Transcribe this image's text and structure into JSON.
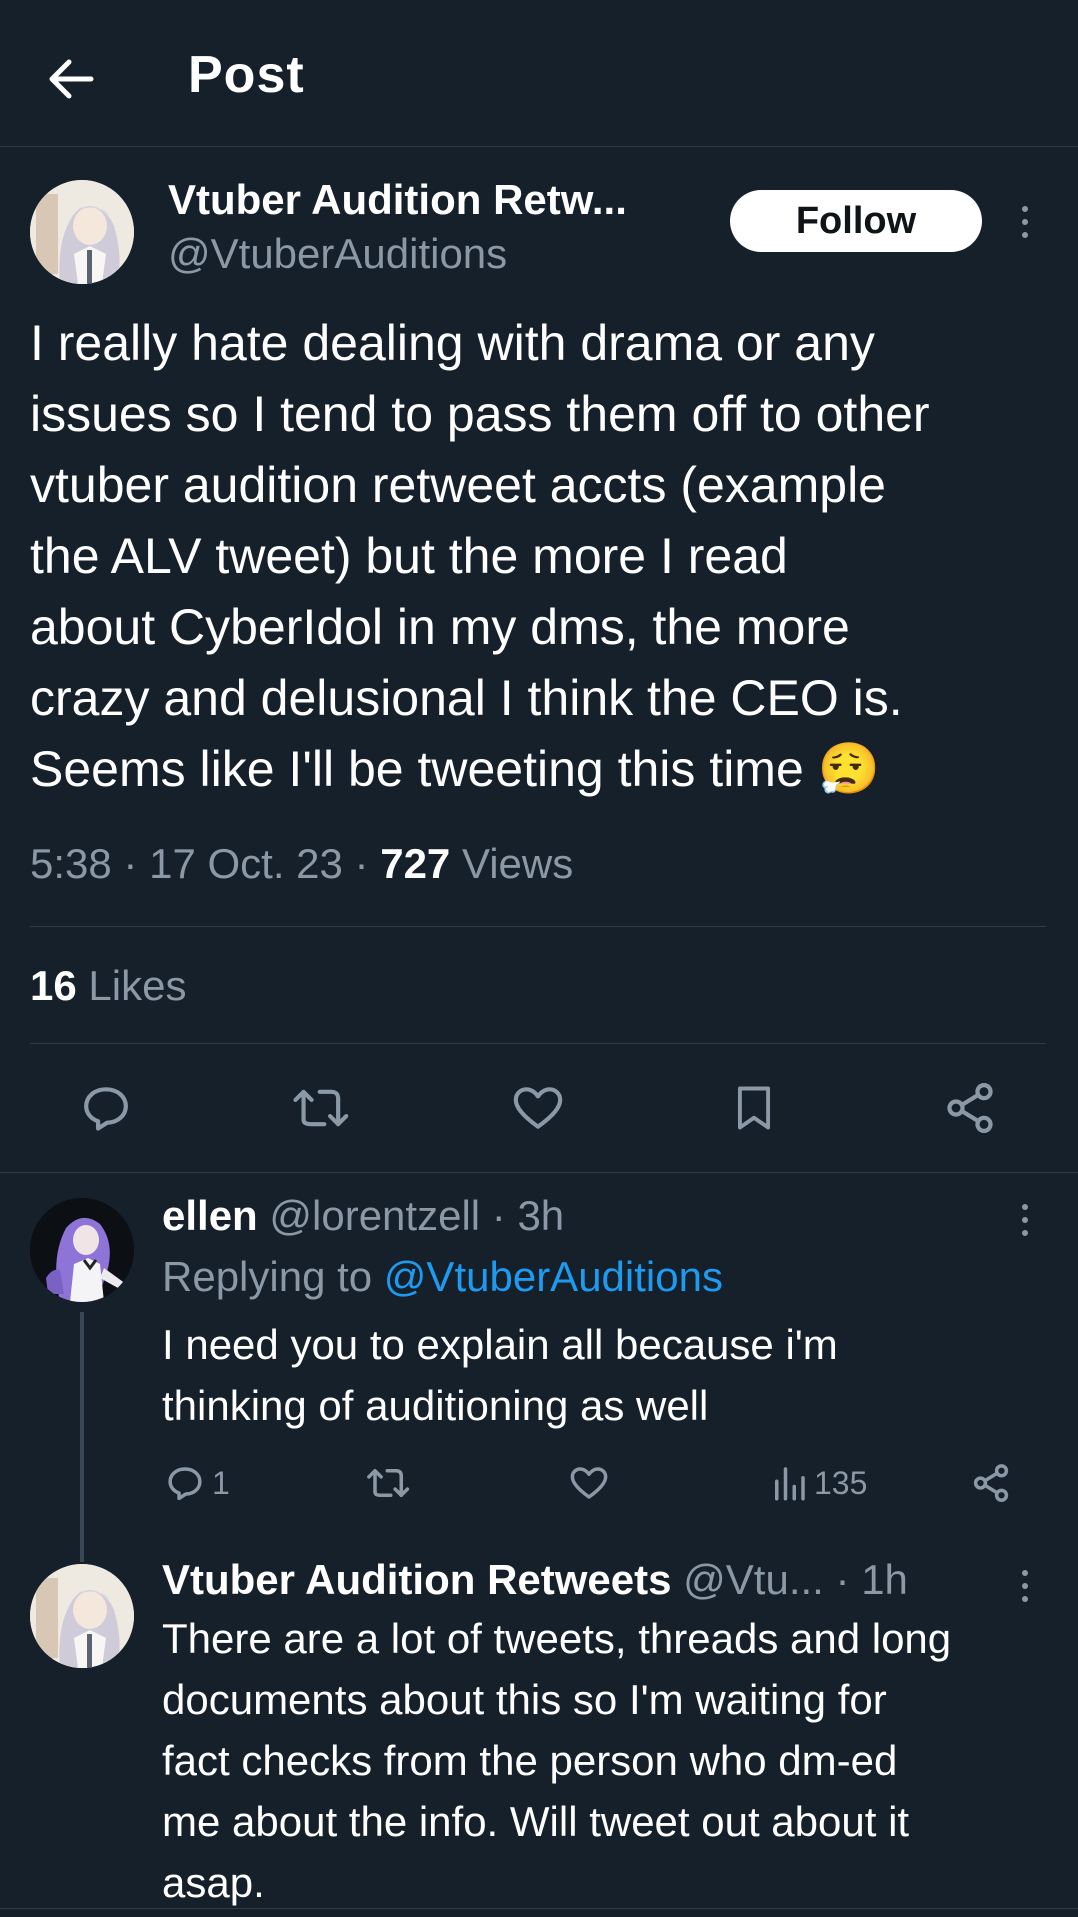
{
  "header": {
    "title": "Post",
    "back_icon": "arrow-left-icon"
  },
  "main_tweet": {
    "author_name": "Vtuber Audition Retw...",
    "author_handle": "@VtuberAuditions",
    "follow_label": "Follow",
    "text_lines": [
      "I really hate dealing with drama or any",
      "issues so I tend to pass them off to other",
      "vtuber audition retweet accts (example",
      "the ALV tweet) but the more I read",
      "about CyberIdol in my dms, the more",
      "crazy and delusional I think the CEO is.",
      "Seems like I'll be tweeting this time"
    ],
    "emoji": "😮‍💨",
    "time": "5:38",
    "date": "17 Oct. 23",
    "sep": "·",
    "views_count": "727",
    "views_label": "Views",
    "likes_count": "16",
    "likes_label": "Likes",
    "actions": [
      "reply-icon",
      "retweet-icon",
      "like-icon",
      "bookmark-icon",
      "share-icon"
    ]
  },
  "replies": [
    {
      "name": "ellen",
      "handle": "@lorentzell",
      "time": "3h",
      "sep": "·",
      "replying_prefix": "Replying to",
      "replying_handle": "@VtuberAuditions",
      "text_lines": [
        "I need you to explain all because i'm",
        "thinking of auditioning as well"
      ],
      "reply_count": "1",
      "view_count": "135"
    },
    {
      "name": "Vtuber Audition Retweets",
      "handle": "@Vtu...",
      "time": "1h",
      "sep": "·",
      "text_lines": [
        "There are a lot of tweets, threads and long",
        "documents about this so I'm waiting for",
        "fact checks from the person who dm-ed",
        "me about the info. Will tweet out about it",
        "asap."
      ]
    }
  ],
  "colors": {
    "background": "#15202b",
    "text_secondary": "#8b98a5",
    "link": "#1d9bf0",
    "divider": "#2f3b47"
  }
}
